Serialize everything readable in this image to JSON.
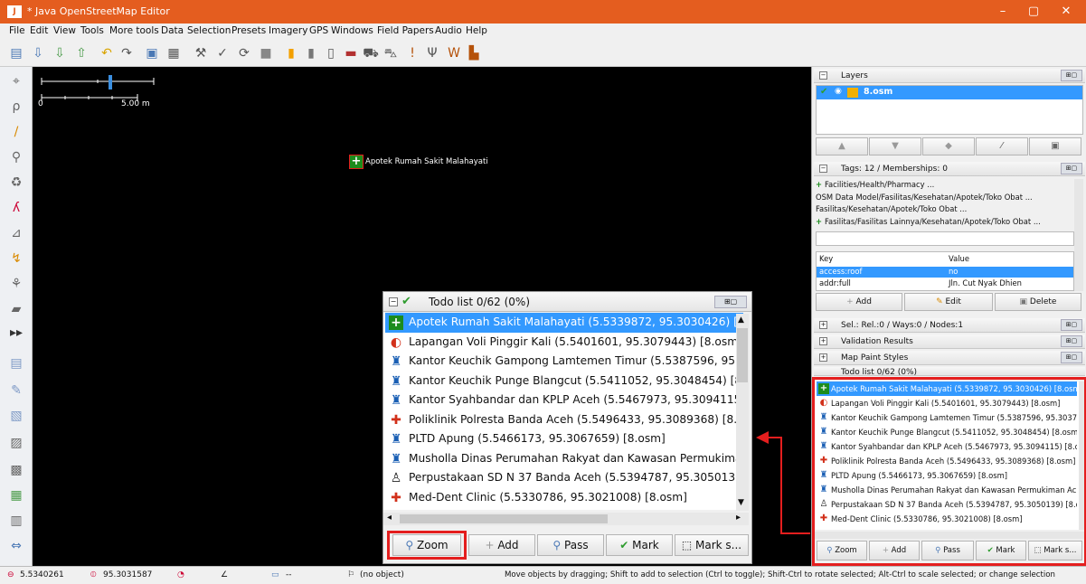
{
  "window": {
    "title": "* Java OpenStreetMap Editor",
    "app_icon": "josm-icon",
    "min": "–",
    "max": "▢",
    "close": "✕"
  },
  "menu": [
    "File",
    "Edit",
    "View",
    "Tools",
    "More tools",
    "Data",
    "Selection",
    "Presets",
    "Imagery",
    "GPS",
    "Windows",
    "Field Papers",
    "Audio",
    "Help"
  ],
  "map": {
    "scale_zero": "0",
    "scale_label": "5.00 m",
    "node_label": "Apotek Rumah Sakit Malahayati"
  },
  "layers": {
    "title": "Layers",
    "items": [
      {
        "name": "8.osm",
        "active": true
      }
    ]
  },
  "tags": {
    "title": "Tags: 12 / Memberships: 0",
    "presets": [
      "Facilities/Health/Pharmacy ...",
      "OSM Data Model/Fasilitas/Kesehatan/Apotek/Toko Obat ...",
      "Fasilitas/Kesehatan/Apotek/Toko Obat ...",
      "Fasilitas/Fasilitas Lainnya/Kesehatan/Apotek/Toko Obat ..."
    ],
    "col_key": "Key",
    "col_value": "Value",
    "rows": [
      {
        "key": "access:roof",
        "value": "no"
      },
      {
        "key": "addr:full",
        "value": "Jln. Cut Nyak Dhien"
      }
    ],
    "add": "Add",
    "edit": "Edit",
    "delete": "Delete"
  },
  "panels": {
    "selection": "Sel.: Rel.:0 / Ways:0 / Nodes:1",
    "validation": "Validation Results",
    "mappaint": "Map Paint Styles",
    "todo_small": "Todo list 0/62 (0%)"
  },
  "todo": {
    "title": "Todo list 0/62 (0%)",
    "items": [
      "Apotek Rumah Sakit Malahayati (5.5339872, 95.3030426) [8.osm]",
      "Lapangan Voli Pinggir Kali (5.5401601, 95.3079443) [8.osm]",
      "Kantor Keuchik Gampong Lamtemen Timur (5.5387596, 95.3037",
      "Kantor Keuchik Punge Blangcut (5.5411052, 95.3048454) [8.osm]",
      "Kantor Syahbandar dan KPLP Aceh (5.5467973, 95.3094115) [8.osm]",
      "Poliklinik Polresta Banda Aceh (5.5496433, 95.3089368) [8.osm]",
      "PLTD Apung (5.5466173, 95.3067659) [8.osm]",
      "Musholla Dinas Perumahan Rakyat dan Kawasan Permukiman Ac",
      "Perpustakaan SD N 37 Banda Aceh (5.5394787, 95.3050139) [8.osm]",
      "Med-Dent Clinic (5.5330786, 95.3021008) [8.osm]"
    ],
    "icons": [
      "pharmacy-icon",
      "volleyball-icon",
      "townhall-icon",
      "townhall-icon",
      "townhall-icon",
      "clinic-icon",
      "townhall-icon",
      "mosque-icon",
      "library-icon",
      "clinic-icon"
    ],
    "buttons": {
      "zoom": "Zoom",
      "add": "Add",
      "pass": "Pass",
      "mark": "Mark",
      "mark_sel": "Mark s..."
    }
  },
  "status": {
    "lat": "5.5340261",
    "lon": "95.3031587",
    "angle": "",
    "dist": "--",
    "obj": "(no object)",
    "help": "Move objects by dragging; Shift to add to selection (Ctrl to toggle); Shift-Ctrl to rotate selected; Alt-Ctrl to scale selected; or change selection"
  },
  "colors": {
    "titlebar": "#e45d1f",
    "highlight": "#e41e1e",
    "selection": "#3399ff"
  }
}
